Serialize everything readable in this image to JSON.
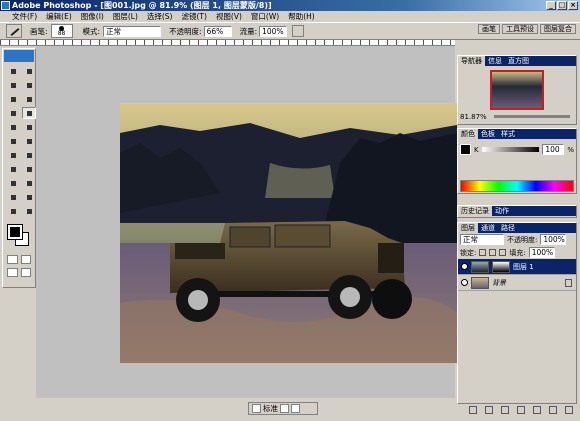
{
  "window": {
    "title": "Adobe Photoshop - [图001.jpg @ 81.9% (图层 1, 图层蒙版/8)]",
    "buttons": [
      "_",
      "□",
      "×"
    ]
  },
  "menu": [
    "文件(F)",
    "编辑(E)",
    "图像(I)",
    "图层(L)",
    "选择(S)",
    "滤镜(T)",
    "视图(V)",
    "窗口(W)",
    "帮助(H)"
  ],
  "options": {
    "brush_label": "画笔:",
    "brush_size": "88",
    "mode_label": "模式:",
    "mode_value": "正常",
    "opacity_label": "不透明度:",
    "opacity_value": "66%",
    "flow_label": "流量:",
    "flow_value": "100%"
  },
  "tabs": [
    "画笔",
    "工具预设",
    "图层复合"
  ],
  "navigator": {
    "tabs": [
      "导航器",
      "信息",
      "直方图"
    ],
    "zoom": "81.87%"
  },
  "color": {
    "tabs": [
      "颜色",
      "色板",
      "样式"
    ],
    "channel": "K",
    "value": "100",
    "unit": "%"
  },
  "history": {
    "tabs": [
      "历史记录",
      "动作"
    ]
  },
  "layers": {
    "tabs": [
      "图层",
      "通道",
      "路径"
    ],
    "blend_mode": "正常",
    "opacity_label": "不透明度:",
    "opacity_value": "100%",
    "lock_label": "锁定:",
    "fill_label": "填充:",
    "fill_value": "100%",
    "items": [
      {
        "name": "图层 1",
        "selected": true
      },
      {
        "name": "背景",
        "selected": false
      }
    ]
  },
  "status": {
    "mode": "标准"
  }
}
